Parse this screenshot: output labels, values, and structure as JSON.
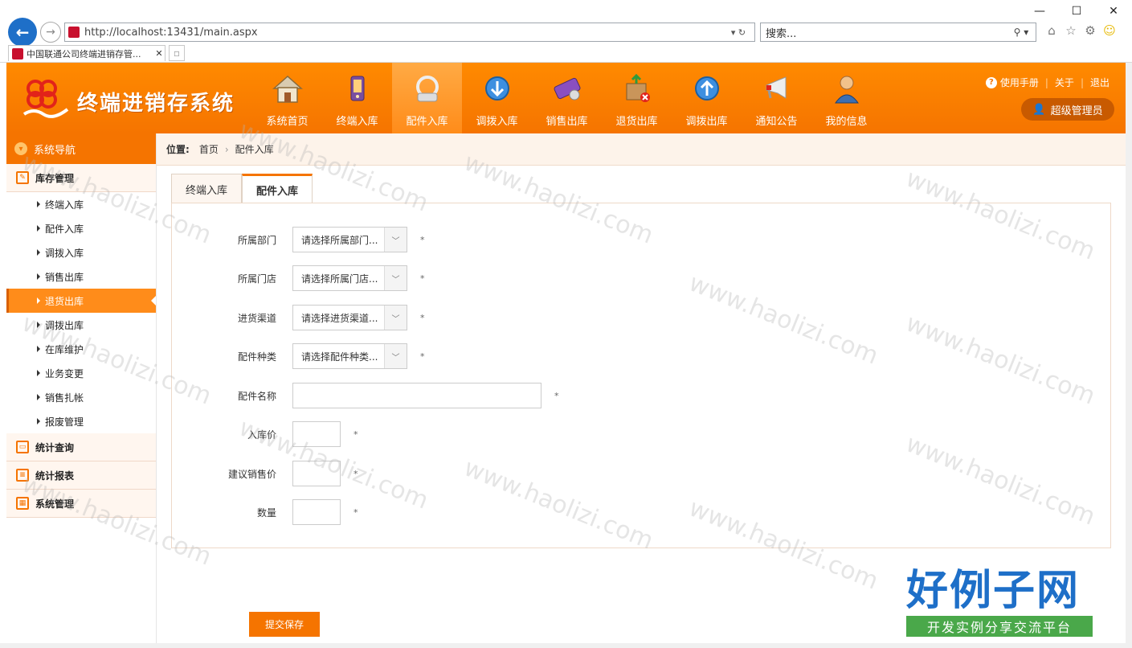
{
  "browser": {
    "url": "http://localhost:13431/main.aspx",
    "search_placeholder": "搜索...",
    "tab_title": "中国联通公司终端进销存管..."
  },
  "app": {
    "title": "终端进销存系统",
    "topnav": [
      {
        "label": "系统首页",
        "icon": "home-icon"
      },
      {
        "label": "终端入库",
        "icon": "phone-icon"
      },
      {
        "label": "配件入库",
        "icon": "accessory-icon"
      },
      {
        "label": "调拨入库",
        "icon": "transfer-in-icon"
      },
      {
        "label": "销售出库",
        "icon": "sale-icon"
      },
      {
        "label": "退货出库",
        "icon": "return-icon"
      },
      {
        "label": "调拨出库",
        "icon": "transfer-out-icon"
      },
      {
        "label": "通知公告",
        "icon": "megaphone-icon"
      },
      {
        "label": "我的信息",
        "icon": "user-icon"
      }
    ],
    "links": {
      "manual": "使用手册",
      "about": "关于",
      "logout": "退出"
    },
    "user": "超级管理员"
  },
  "sidebar": {
    "header": "系统导航",
    "groups": [
      {
        "label": "库存管理"
      },
      {
        "label": "统计查询"
      },
      {
        "label": "统计报表"
      },
      {
        "label": "系统管理"
      }
    ],
    "items": [
      "终端入库",
      "配件入库",
      "调拨入库",
      "销售出库",
      "退货出库",
      "调拨出库",
      "在库维护",
      "业务变更",
      "销售扎帐",
      "报废管理"
    ]
  },
  "breadcrumb": {
    "label": "位置:",
    "home": "首页",
    "current": "配件入库"
  },
  "tabs": [
    "终端入库",
    "配件入库"
  ],
  "form": {
    "dept_label": "所属部门",
    "dept_value": "请选择所属部门...",
    "store_label": "所属门店",
    "store_value": "请选择所属门店...",
    "channel_label": "进货渠道",
    "channel_value": "请选择进货渠道...",
    "type_label": "配件种类",
    "type_value": "请选择配件种类...",
    "name_label": "配件名称",
    "price_label": "入库价",
    "suggest_label": "建议销售价",
    "qty_label": "数量",
    "required": "*",
    "submit": "提交保存"
  },
  "watermark": {
    "text": "www.haolizi.com",
    "brand": "好例子网",
    "slogan": "开发实例分享交流平台"
  }
}
